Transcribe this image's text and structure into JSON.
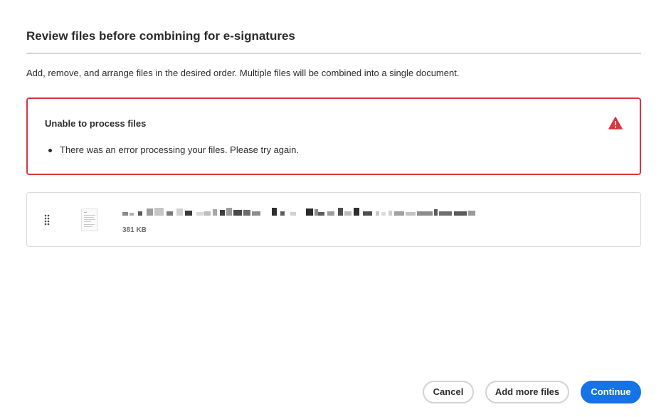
{
  "dialog": {
    "title": "Review files before combining for e-signatures",
    "subtitle": "Add, remove, and arrange files in the desired order. Multiple files will be combined into a single document."
  },
  "error": {
    "title": "Unable to process files",
    "icon": "warning-icon",
    "color": "#d7373f",
    "messages": [
      "There was an error processing your files. Please try again."
    ]
  },
  "files": [
    {
      "size": "381 KB",
      "icon": "document-thumbnail",
      "name_redacted": true
    }
  ],
  "buttons": {
    "cancel": "Cancel",
    "add_more": "Add more files",
    "continue": "Continue"
  },
  "colors": {
    "primary": "#1473e6",
    "error": "#d7373f"
  }
}
